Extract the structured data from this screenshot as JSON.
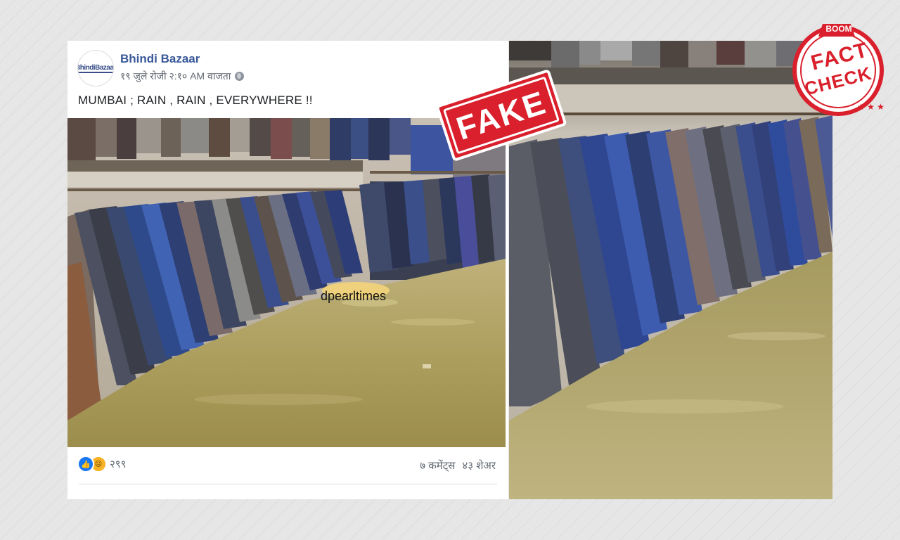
{
  "post": {
    "page_name": "Bhindi Bazaar",
    "avatar_logo_text": "BhindiBazaar",
    "timestamp": "१९ जुले रोजी २:१० AM वाजता",
    "privacy_icon": "globe-icon",
    "text": "MUMBAI ; RAIN , RAIN , EVERYWHERE !!",
    "photo_watermark": "dpearltimes",
    "reactions": {
      "icons": [
        "like-icon",
        "sad-icon"
      ],
      "count": "२९९"
    },
    "comments": "७ कमेंट्स",
    "shares": "४३ शेअर"
  },
  "stamps": {
    "fake": "FAKE",
    "fact_check_top": "BOOM",
    "fact_check_line1": "FACT",
    "fact_check_line2": "CHECK"
  },
  "colors": {
    "link_blue": "#385898",
    "stamp_red": "#d9202c",
    "water": "#a89a55"
  }
}
